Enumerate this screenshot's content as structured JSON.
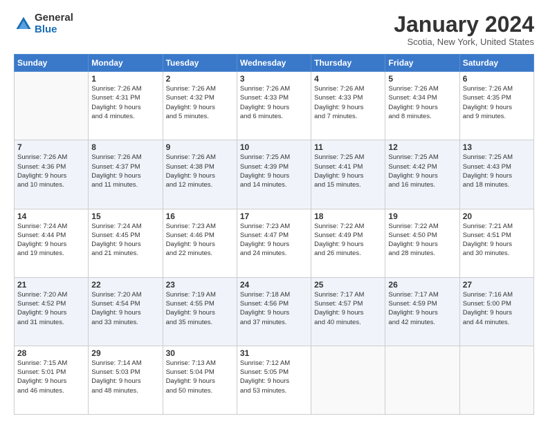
{
  "header": {
    "logo_general": "General",
    "logo_blue": "Blue",
    "month_title": "January 2024",
    "location": "Scotia, New York, United States"
  },
  "weekdays": [
    "Sunday",
    "Monday",
    "Tuesday",
    "Wednesday",
    "Thursday",
    "Friday",
    "Saturday"
  ],
  "weeks": [
    [
      {
        "day": "",
        "sunrise": "",
        "sunset": "",
        "daylight": ""
      },
      {
        "day": "1",
        "sunrise": "Sunrise: 7:26 AM",
        "sunset": "Sunset: 4:31 PM",
        "daylight": "Daylight: 9 hours and 4 minutes."
      },
      {
        "day": "2",
        "sunrise": "Sunrise: 7:26 AM",
        "sunset": "Sunset: 4:32 PM",
        "daylight": "Daylight: 9 hours and 5 minutes."
      },
      {
        "day": "3",
        "sunrise": "Sunrise: 7:26 AM",
        "sunset": "Sunset: 4:33 PM",
        "daylight": "Daylight: 9 hours and 6 minutes."
      },
      {
        "day": "4",
        "sunrise": "Sunrise: 7:26 AM",
        "sunset": "Sunset: 4:33 PM",
        "daylight": "Daylight: 9 hours and 7 minutes."
      },
      {
        "day": "5",
        "sunrise": "Sunrise: 7:26 AM",
        "sunset": "Sunset: 4:34 PM",
        "daylight": "Daylight: 9 hours and 8 minutes."
      },
      {
        "day": "6",
        "sunrise": "Sunrise: 7:26 AM",
        "sunset": "Sunset: 4:35 PM",
        "daylight": "Daylight: 9 hours and 9 minutes."
      }
    ],
    [
      {
        "day": "7",
        "sunrise": "Sunrise: 7:26 AM",
        "sunset": "Sunset: 4:36 PM",
        "daylight": "Daylight: 9 hours and 10 minutes."
      },
      {
        "day": "8",
        "sunrise": "Sunrise: 7:26 AM",
        "sunset": "Sunset: 4:37 PM",
        "daylight": "Daylight: 9 hours and 11 minutes."
      },
      {
        "day": "9",
        "sunrise": "Sunrise: 7:26 AM",
        "sunset": "Sunset: 4:38 PM",
        "daylight": "Daylight: 9 hours and 12 minutes."
      },
      {
        "day": "10",
        "sunrise": "Sunrise: 7:25 AM",
        "sunset": "Sunset: 4:39 PM",
        "daylight": "Daylight: 9 hours and 14 minutes."
      },
      {
        "day": "11",
        "sunrise": "Sunrise: 7:25 AM",
        "sunset": "Sunset: 4:41 PM",
        "daylight": "Daylight: 9 hours and 15 minutes."
      },
      {
        "day": "12",
        "sunrise": "Sunrise: 7:25 AM",
        "sunset": "Sunset: 4:42 PM",
        "daylight": "Daylight: 9 hours and 16 minutes."
      },
      {
        "day": "13",
        "sunrise": "Sunrise: 7:25 AM",
        "sunset": "Sunset: 4:43 PM",
        "daylight": "Daylight: 9 hours and 18 minutes."
      }
    ],
    [
      {
        "day": "14",
        "sunrise": "Sunrise: 7:24 AM",
        "sunset": "Sunset: 4:44 PM",
        "daylight": "Daylight: 9 hours and 19 minutes."
      },
      {
        "day": "15",
        "sunrise": "Sunrise: 7:24 AM",
        "sunset": "Sunset: 4:45 PM",
        "daylight": "Daylight: 9 hours and 21 minutes."
      },
      {
        "day": "16",
        "sunrise": "Sunrise: 7:23 AM",
        "sunset": "Sunset: 4:46 PM",
        "daylight": "Daylight: 9 hours and 22 minutes."
      },
      {
        "day": "17",
        "sunrise": "Sunrise: 7:23 AM",
        "sunset": "Sunset: 4:47 PM",
        "daylight": "Daylight: 9 hours and 24 minutes."
      },
      {
        "day": "18",
        "sunrise": "Sunrise: 7:22 AM",
        "sunset": "Sunset: 4:49 PM",
        "daylight": "Daylight: 9 hours and 26 minutes."
      },
      {
        "day": "19",
        "sunrise": "Sunrise: 7:22 AM",
        "sunset": "Sunset: 4:50 PM",
        "daylight": "Daylight: 9 hours and 28 minutes."
      },
      {
        "day": "20",
        "sunrise": "Sunrise: 7:21 AM",
        "sunset": "Sunset: 4:51 PM",
        "daylight": "Daylight: 9 hours and 30 minutes."
      }
    ],
    [
      {
        "day": "21",
        "sunrise": "Sunrise: 7:20 AM",
        "sunset": "Sunset: 4:52 PM",
        "daylight": "Daylight: 9 hours and 31 minutes."
      },
      {
        "day": "22",
        "sunrise": "Sunrise: 7:20 AM",
        "sunset": "Sunset: 4:54 PM",
        "daylight": "Daylight: 9 hours and 33 minutes."
      },
      {
        "day": "23",
        "sunrise": "Sunrise: 7:19 AM",
        "sunset": "Sunset: 4:55 PM",
        "daylight": "Daylight: 9 hours and 35 minutes."
      },
      {
        "day": "24",
        "sunrise": "Sunrise: 7:18 AM",
        "sunset": "Sunset: 4:56 PM",
        "daylight": "Daylight: 9 hours and 37 minutes."
      },
      {
        "day": "25",
        "sunrise": "Sunrise: 7:17 AM",
        "sunset": "Sunset: 4:57 PM",
        "daylight": "Daylight: 9 hours and 40 minutes."
      },
      {
        "day": "26",
        "sunrise": "Sunrise: 7:17 AM",
        "sunset": "Sunset: 4:59 PM",
        "daylight": "Daylight: 9 hours and 42 minutes."
      },
      {
        "day": "27",
        "sunrise": "Sunrise: 7:16 AM",
        "sunset": "Sunset: 5:00 PM",
        "daylight": "Daylight: 9 hours and 44 minutes."
      }
    ],
    [
      {
        "day": "28",
        "sunrise": "Sunrise: 7:15 AM",
        "sunset": "Sunset: 5:01 PM",
        "daylight": "Daylight: 9 hours and 46 minutes."
      },
      {
        "day": "29",
        "sunrise": "Sunrise: 7:14 AM",
        "sunset": "Sunset: 5:03 PM",
        "daylight": "Daylight: 9 hours and 48 minutes."
      },
      {
        "day": "30",
        "sunrise": "Sunrise: 7:13 AM",
        "sunset": "Sunset: 5:04 PM",
        "daylight": "Daylight: 9 hours and 50 minutes."
      },
      {
        "day": "31",
        "sunrise": "Sunrise: 7:12 AM",
        "sunset": "Sunset: 5:05 PM",
        "daylight": "Daylight: 9 hours and 53 minutes."
      },
      {
        "day": "",
        "sunrise": "",
        "sunset": "",
        "daylight": ""
      },
      {
        "day": "",
        "sunrise": "",
        "sunset": "",
        "daylight": ""
      },
      {
        "day": "",
        "sunrise": "",
        "sunset": "",
        "daylight": ""
      }
    ]
  ]
}
